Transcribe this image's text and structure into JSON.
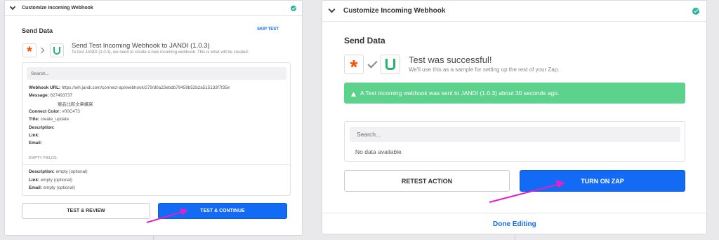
{
  "left": {
    "header": {
      "title": "Customize Incoming Webhook"
    },
    "section_title": "Send Data",
    "skip_label": "SKIP TEST",
    "step_title": "Send Test Incoming Webhook to JANDI (1.0.3)",
    "step_desc": "To test JANDI (1.0.3), we need to create a new incoming webhook. This is what will be created:",
    "search_placeholder": "Search...",
    "fields": [
      {
        "label": "Webhook URL:",
        "value": "https://wh.jandi.com/connect-api/webhook/279/d0a23ebdb79459b52b2a515133f7f35e"
      },
      {
        "label": "Message:",
        "value": "827493737"
      },
      {
        "label": "",
        "value": "競品比較文章擴寫"
      },
      {
        "label": "Connect Color:",
        "value": "#00C473"
      },
      {
        "label": "Title:",
        "value": "create_update"
      },
      {
        "label": "Description:",
        "value": ""
      },
      {
        "label": "Link:",
        "value": ""
      },
      {
        "label": "Email:",
        "value": ""
      }
    ],
    "empty_fields_label": "EMPTY FIELDS:",
    "empty_fields": [
      {
        "label": "Description:",
        "value": "empty (optional)"
      },
      {
        "label": "Link:",
        "value": "empty (optional)"
      },
      {
        "label": "Email:",
        "value": "empty (optional)"
      }
    ],
    "btn_review": "TEST & REVIEW",
    "btn_continue": "TEST & CONTINUE"
  },
  "right": {
    "header": {
      "title": "Customize Incoming Webhook"
    },
    "section_title": "Send Data",
    "success_title": "Test was successful!",
    "success_desc": "We'll use this as a sample for setting up the rest of your Zap.",
    "banner": "A Test incoming webhook was sent to JANDI (1.0.3) about 30 seconds ago.",
    "search_placeholder": "Search...",
    "no_data": "No data available",
    "btn_retest": "RETEST ACTION",
    "btn_turn_on": "TURN ON ZAP",
    "done_editing": "Done Editing"
  },
  "icons": {
    "trigger": "zapier-asterisk-icon",
    "action": "jandi-j-icon",
    "arrow": "chevron-right-icon",
    "success": "checkmark-icon",
    "complete": "check-circle-icon",
    "banner": "flask-icon",
    "collapse": "chevron-down-icon",
    "annotation": "pink-pointer-arrow"
  },
  "colors": {
    "primary_button": "#136bf5",
    "success_banner": "#5dd28c",
    "complete_badge": "#29b39d",
    "zapier_orange": "#ff4a00",
    "jandi_green": "#1fb86a",
    "annotation": "#e020c8"
  }
}
